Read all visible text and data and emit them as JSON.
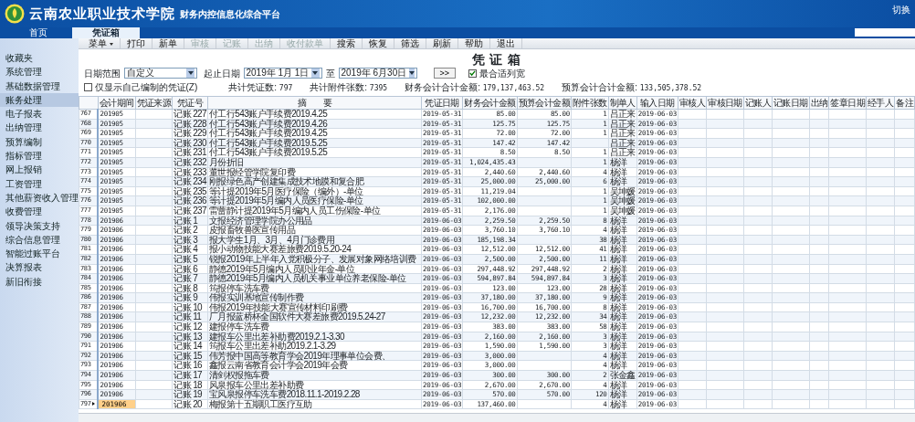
{
  "header": {
    "logo_text": "云南农业职业技术学院",
    "subtitle": "财务内控信息化综合平台",
    "switch_link": "切换"
  },
  "tabs": [
    {
      "label": "首页",
      "selected": false
    },
    {
      "label": "凭证箱",
      "selected": true
    }
  ],
  "toolbar": [
    {
      "label": "菜单",
      "kind": "dropdown",
      "disabled": false
    },
    {
      "label": "打印",
      "kind": "button",
      "disabled": false
    },
    {
      "label": "新单",
      "kind": "button",
      "disabled": false
    },
    {
      "label": "审核",
      "kind": "button",
      "disabled": true
    },
    {
      "label": "记账",
      "kind": "button",
      "disabled": true
    },
    {
      "label": "出纳",
      "kind": "button",
      "disabled": true
    },
    {
      "label": "收付款单",
      "kind": "button",
      "disabled": true
    },
    {
      "label": "搜索",
      "kind": "button",
      "disabled": false
    },
    {
      "label": "恢复",
      "kind": "button",
      "disabled": false
    },
    {
      "label": "筛选",
      "kind": "button",
      "disabled": false
    },
    {
      "label": "刷新",
      "kind": "button",
      "disabled": false
    },
    {
      "label": "帮助",
      "kind": "button",
      "disabled": false
    },
    {
      "label": "退出",
      "kind": "button",
      "disabled": false
    }
  ],
  "sidebar": {
    "items": [
      {
        "label": "收藏夹",
        "selected": false
      },
      {
        "label": "系统管理",
        "selected": false
      },
      {
        "label": "基础数据管理",
        "selected": false
      },
      {
        "label": "账务处理",
        "selected": true
      },
      {
        "label": "电子报表",
        "selected": false
      },
      {
        "label": "出纳管理",
        "selected": false
      },
      {
        "label": "预算编制",
        "selected": false
      },
      {
        "label": "指标管理",
        "selected": false
      },
      {
        "label": "网上报销",
        "selected": false
      },
      {
        "label": "工资管理",
        "selected": false
      },
      {
        "label": "其他薪资收入管理",
        "selected": false
      },
      {
        "label": "收费管理",
        "selected": false
      },
      {
        "label": "领导决策支持",
        "selected": false
      },
      {
        "label": "综合信息管理",
        "selected": false
      },
      {
        "label": "智能过账平台",
        "selected": false
      },
      {
        "label": "决算报表",
        "selected": false
      },
      {
        "label": "新旧衔接",
        "selected": false
      }
    ]
  },
  "page_title": "凭 证 箱",
  "filters": {
    "date_range": {
      "label": "日期范围",
      "value": "自定义"
    },
    "period": {
      "label": "起止日期",
      "from": "2019年 1月 1日",
      "separator": "至",
      "to": "2019年 6月30日"
    },
    "go_button": ">>",
    "best_fit": {
      "label": "最合适列宽",
      "checked": true
    },
    "own_only": {
      "label": "仅显示自己编制的凭证(Z)",
      "checked": false
    }
  },
  "summary_stats": [
    {
      "label": "共计凭证数:",
      "value": "797"
    },
    {
      "label": "共计附件张数:",
      "value": "7395"
    },
    {
      "label": "财务会计合计金额:",
      "value": "179,137,463.52"
    },
    {
      "label": "预算会计合计金额:",
      "value": "133,505,378.52"
    }
  ],
  "table": {
    "columns": [
      "会计期间",
      "凭证来源",
      "凭证号",
      "摘　　要",
      "凭证日期",
      "财务会计金额",
      "预算会计金额",
      "附件张数",
      "制单人",
      "输入日期",
      "审核人",
      "审核日期",
      "记账人",
      "记账日期",
      "出纳",
      "签章日期",
      "经手人",
      "备注"
    ],
    "rows": [
      {
        "n": "767",
        "period": "201905",
        "voucher": "记账 227",
        "summary": "付工行543账户手续费2019.4.25",
        "date": "2019-05-31",
        "finance": "85.00",
        "budget": "85.00",
        "attachments": "1",
        "maker": "吕正来",
        "input_date": "2019-06-03",
        "selected": false
      },
      {
        "n": "768",
        "period": "201905",
        "voucher": "记账 228",
        "summary": "付工行543账户手续费2019.4.26",
        "date": "2019-05-31",
        "finance": "125.75",
        "budget": "125.75",
        "attachments": "1",
        "maker": "吕正来",
        "input_date": "2019-06-03",
        "selected": false
      },
      {
        "n": "769",
        "period": "201905",
        "voucher": "记账 229",
        "summary": "付工行543账户手续费2019.4.25",
        "date": "2019-05-31",
        "finance": "72.00",
        "budget": "72.00",
        "attachments": "1",
        "maker": "吕正来",
        "input_date": "2019-06-03",
        "selected": false
      },
      {
        "n": "770",
        "period": "201905",
        "voucher": "记账 230",
        "summary": "付工行543账户手续费2019.5.25",
        "date": "2019-05-31",
        "finance": "147.42",
        "budget": "147.42",
        "maker": "吕正来",
        "input_date": "2019-06-03",
        "selected": false
      },
      {
        "n": "771",
        "period": "201905",
        "voucher": "记账 231",
        "summary": "付工行543账户手续费2019.5.25",
        "date": "2019-05-31",
        "finance": "8.50",
        "budget": "8.50",
        "attachments": "1",
        "maker": "吕正来",
        "input_date": "2019-06-03",
        "selected": false
      },
      {
        "n": "772",
        "period": "201905",
        "voucher": "记账 232",
        "summary": "月份折旧",
        "date": "2019-05-31",
        "finance": "1,024,435.43",
        "attachments": "1",
        "maker": "杨洋",
        "input_date": "2019-06-03",
        "selected": false
      },
      {
        "n": "773",
        "period": "201905",
        "voucher": "记账 233",
        "summary": "董世报经管学院复印费",
        "date": "2019-05-31",
        "finance": "2,440.60",
        "budget": "2,440.60",
        "attachments": "4",
        "maker": "杨洋",
        "input_date": "2019-06-03",
        "selected": false
      },
      {
        "n": "774",
        "period": "201905",
        "voucher": "记账 234",
        "summary": "刚报绿色高产创建集成技术地膜和复合肥",
        "date": "2019-05-31",
        "finance": "25,000.00",
        "budget": "25,000.00",
        "attachments": "6",
        "maker": "杨洋",
        "input_date": "2019-06-03",
        "selected": false
      },
      {
        "n": "775",
        "period": "201905",
        "voucher": "记账 235",
        "summary": "等计提2019年5月医疗保险（编外）-单位",
        "date": "2019-05-31",
        "finance": "11,219.04",
        "attachments": "1",
        "maker": "吴坤媛",
        "input_date": "2019-06-03",
        "selected": false
      },
      {
        "n": "776",
        "period": "201905",
        "voucher": "记账 236",
        "summary": "等计提2019年5月编内人员医疗保险-单位",
        "date": "2019-05-31",
        "finance": "102,000.00",
        "attachments": "1",
        "maker": "吴坤媛",
        "input_date": "2019-06-03",
        "selected": false
      },
      {
        "n": "777",
        "period": "201905",
        "voucher": "记账 237",
        "summary": "雷蕾静计提2019年5月编内人员工伤保险-单位",
        "date": "2019-05-31",
        "finance": "2,176.00",
        "attachments": "1",
        "maker": "吴坤媛",
        "input_date": "2019-06-03",
        "selected": false
      },
      {
        "n": "778",
        "period": "201906",
        "voucher": "记账 1",
        "summary": "文报经济管理学院办公用品",
        "date": "2019-06-03",
        "finance": "2,259.50",
        "budget": "2,259.50",
        "attachments": "8",
        "maker": "杨洋",
        "input_date": "2019-06-03",
        "selected": false
      },
      {
        "n": "779",
        "period": "201906",
        "voucher": "记账 2",
        "summary": "皮报畜牧兽医宣传用品",
        "date": "2019-06-03",
        "finance": "3,760.10",
        "budget": "3,760.10",
        "attachments": "4",
        "maker": "杨洋",
        "input_date": "2019-06-03",
        "selected": false
      },
      {
        "n": "780",
        "period": "201906",
        "voucher": "记账 3",
        "summary": "报大学生1月、3月、4月门诊费用",
        "date": "2019-06-03",
        "finance": "185,198.34",
        "attachments": "38",
        "maker": "杨洋",
        "input_date": "2019-06-03",
        "selected": false
      },
      {
        "n": "781",
        "period": "201906",
        "voucher": "记账 4",
        "summary": "报小动物技能大赛差旅费2019.5.20-24",
        "date": "2019-06-03",
        "finance": "12,512.00",
        "budget": "12,512.00",
        "attachments": "41",
        "maker": "杨洋",
        "input_date": "2019-06-03",
        "selected": false
      },
      {
        "n": "782",
        "period": "201906",
        "voucher": "记账 5",
        "summary": "锐报2019年上半年入党积极分子、发展对象网络培训费",
        "date": "2019-06-03",
        "finance": "2,500.00",
        "budget": "2,500.00",
        "attachments": "11",
        "maker": "杨洋",
        "input_date": "2019-06-03",
        "selected": false
      },
      {
        "n": "783",
        "period": "201906",
        "voucher": "记账 6",
        "summary": "静德2019年5月编内人员职业年金-单位",
        "date": "2019-06-03",
        "finance": "297,448.92",
        "budget": "297,448.92",
        "attachments": "2",
        "maker": "杨洋",
        "input_date": "2019-06-03",
        "selected": false
      },
      {
        "n": "784",
        "period": "201906",
        "voucher": "记账 7",
        "summary": "静德2019年5月编内人员机关事业单位养老保险-单位",
        "date": "2019-06-03",
        "finance": "594,897.84",
        "budget": "594,897.84",
        "attachments": "3",
        "maker": "杨洋",
        "input_date": "2019-06-03",
        "selected": false
      },
      {
        "n": "785",
        "period": "201906",
        "voucher": "记账 8",
        "summary": "筠报停车洗车费",
        "date": "2019-06-03",
        "finance": "123.00",
        "budget": "123.00",
        "attachments": "28",
        "maker": "杨洋",
        "input_date": "2019-06-03",
        "selected": false
      },
      {
        "n": "786",
        "period": "201906",
        "voucher": "记账 9",
        "summary": "伟报实训基地宣传制作费",
        "date": "2019-06-03",
        "finance": "37,180.00",
        "budget": "37,180.00",
        "attachments": "9",
        "maker": "杨洋",
        "input_date": "2019-06-03",
        "selected": false
      },
      {
        "n": "787",
        "period": "201906",
        "voucher": "记账 10",
        "summary": "伟报2019年技能大赛宣传材料印刷费",
        "date": "2019-06-03",
        "finance": "16,700.00",
        "budget": "16,700.00",
        "attachments": "8",
        "maker": "杨洋",
        "input_date": "2019-06-03",
        "selected": false
      },
      {
        "n": "788",
        "period": "201906",
        "voucher": "记账 11",
        "summary": "厂月报蓝桥杯全国软件大赛差旅费2019.5.24-27",
        "date": "2019-06-03",
        "finance": "12,232.00",
        "budget": "12,232.00",
        "attachments": "34",
        "maker": "杨洋",
        "input_date": "2019-06-03",
        "selected": false
      },
      {
        "n": "789",
        "period": "201906",
        "voucher": "记账 12",
        "summary": "建报停车洗车费",
        "date": "2019-06-03",
        "finance": "383.00",
        "budget": "383.00",
        "attachments": "58",
        "maker": "杨洋",
        "input_date": "2019-06-03",
        "selected": false
      },
      {
        "n": "790",
        "period": "201906",
        "voucher": "记账 13",
        "summary": "建报车公里出差补助费2019.2.1-3.30",
        "date": "2019-06-03",
        "finance": "2,160.00",
        "budget": "2,160.00",
        "attachments": "3",
        "maker": "杨洋",
        "input_date": "2019-06-03",
        "selected": false
      },
      {
        "n": "791",
        "period": "201906",
        "voucher": "记账 14",
        "summary": "筠报车公里出差补助2019.2.1-3.29",
        "date": "2019-06-03",
        "finance": "1,590.00",
        "budget": "1,590.00",
        "attachments": "3",
        "maker": "杨洋",
        "input_date": "2019-06-03",
        "selected": false
      },
      {
        "n": "792",
        "period": "201906",
        "voucher": "记账 15",
        "summary": "伟芳报中国高等教育学会2019年理事单位会费、",
        "date": "2019-06-03",
        "finance": "3,000.00",
        "attachments": "4",
        "maker": "杨洋",
        "input_date": "2019-06-03",
        "selected": false
      },
      {
        "n": "793",
        "period": "201906",
        "voucher": "记账 16",
        "summary": "鑫报云南省教育会计学会2019年会费",
        "date": "2019-06-03",
        "finance": "3,000.00",
        "attachments": "4",
        "maker": "杨洋",
        "input_date": "2019-06-03",
        "selected": false
      },
      {
        "n": "794",
        "period": "201906",
        "voucher": "记账 17",
        "summary": "清剑权报拖车费",
        "date": "2019-06-03",
        "finance": "300.00",
        "budget": "300.00",
        "attachments": "2",
        "maker": "张金鑫",
        "input_date": "2019-06-03",
        "selected": false
      },
      {
        "n": "795",
        "period": "201906",
        "voucher": "记账 18",
        "summary": "风泉报车公里出差补助费",
        "date": "2019-06-03",
        "finance": "2,670.00",
        "budget": "2,670.00",
        "attachments": "4",
        "maker": "杨洋",
        "input_date": "2019-06-03",
        "selected": false
      },
      {
        "n": "796",
        "period": "201906",
        "voucher": "记账 19",
        "summary": "宝风泉报停车洗车费2018.11.1-2019.2.28",
        "date": "2019-06-03",
        "finance": "570.00",
        "budget": "570.00",
        "attachments": "120",
        "maker": "杨洋",
        "input_date": "2019-06-03",
        "selected": false
      },
      {
        "n": "797",
        "period": "201906",
        "voucher": "记账 20",
        "summary": "梅报第十五期职工医疗互助",
        "date": "2019-06-03",
        "finance": "137,460.00",
        "attachments": "4",
        "maker": "杨洋",
        "input_date": "2019-06-03",
        "selected": true
      }
    ]
  }
}
